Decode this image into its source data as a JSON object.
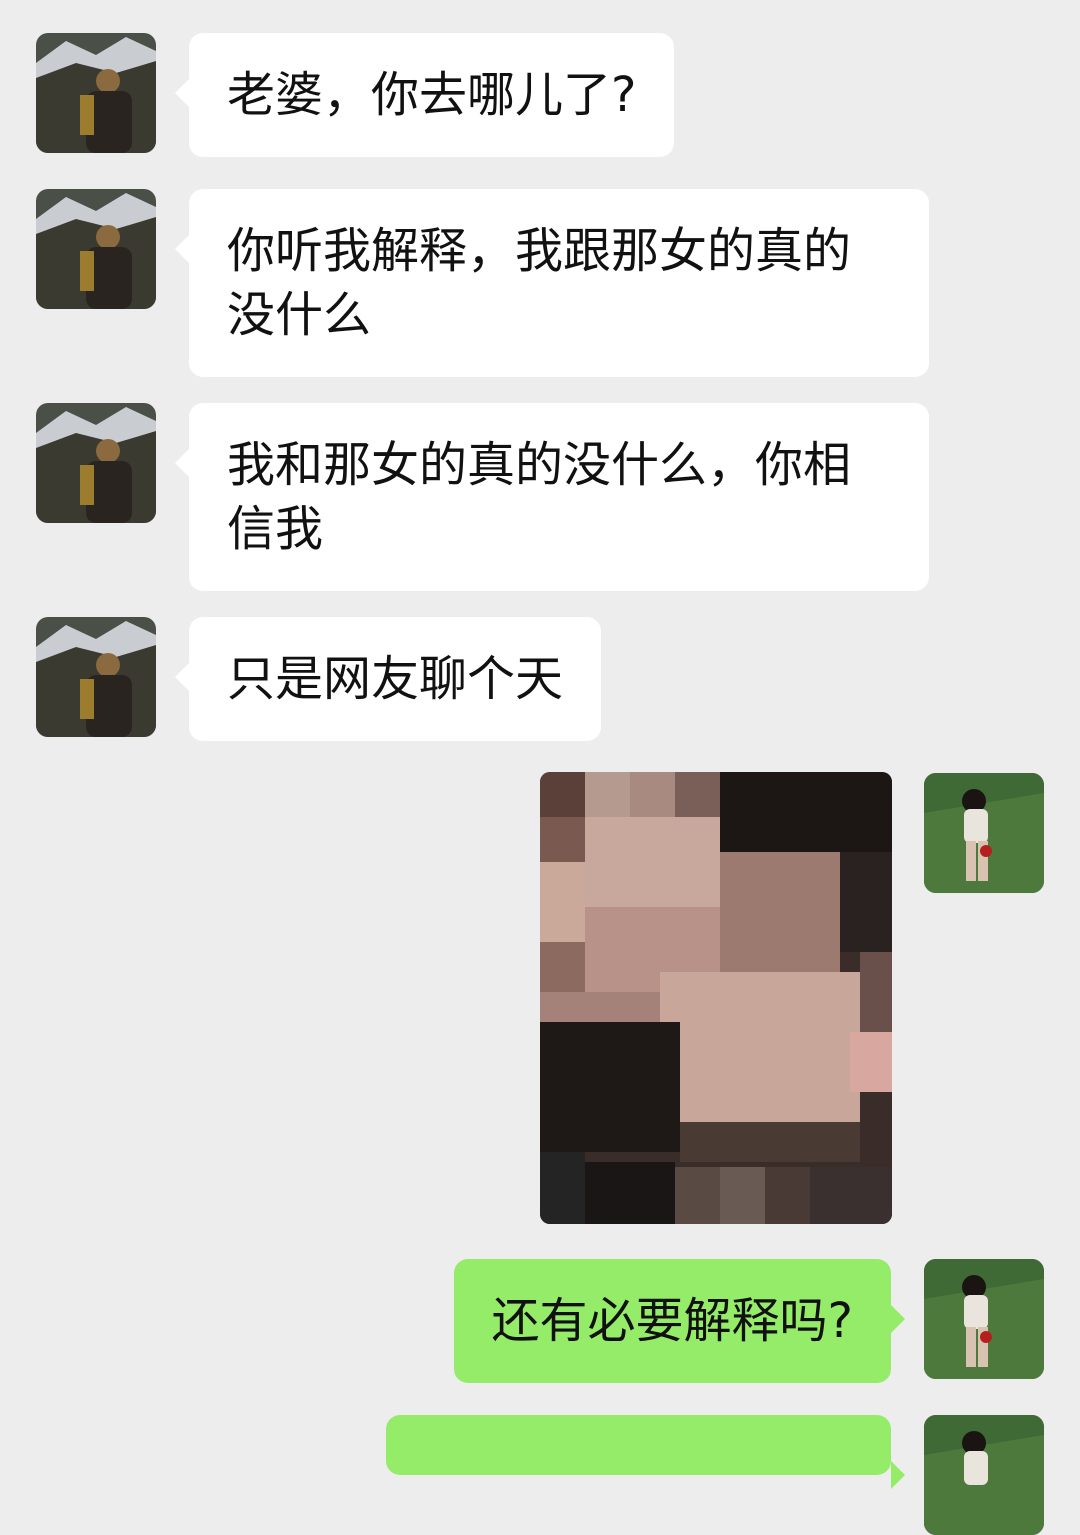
{
  "chat": {
    "messages": [
      {
        "sender": "contact",
        "text": "老婆，你去哪儿了?"
      },
      {
        "sender": "contact",
        "text": "你听我解释，我跟那女的真的没什么"
      },
      {
        "sender": "contact",
        "text": "我和那女的真的没什么，你相信我"
      },
      {
        "sender": "contact",
        "text": "只是网友聊个天"
      },
      {
        "sender": "me",
        "type": "image",
        "content": "pixelated photo"
      },
      {
        "sender": "me",
        "text": "还有必要解释吗?"
      },
      {
        "sender": "me",
        "text": ""
      }
    ]
  },
  "colors": {
    "background": "#ededed",
    "incoming_bubble": "#ffffff",
    "outgoing_bubble": "#95ec69"
  }
}
